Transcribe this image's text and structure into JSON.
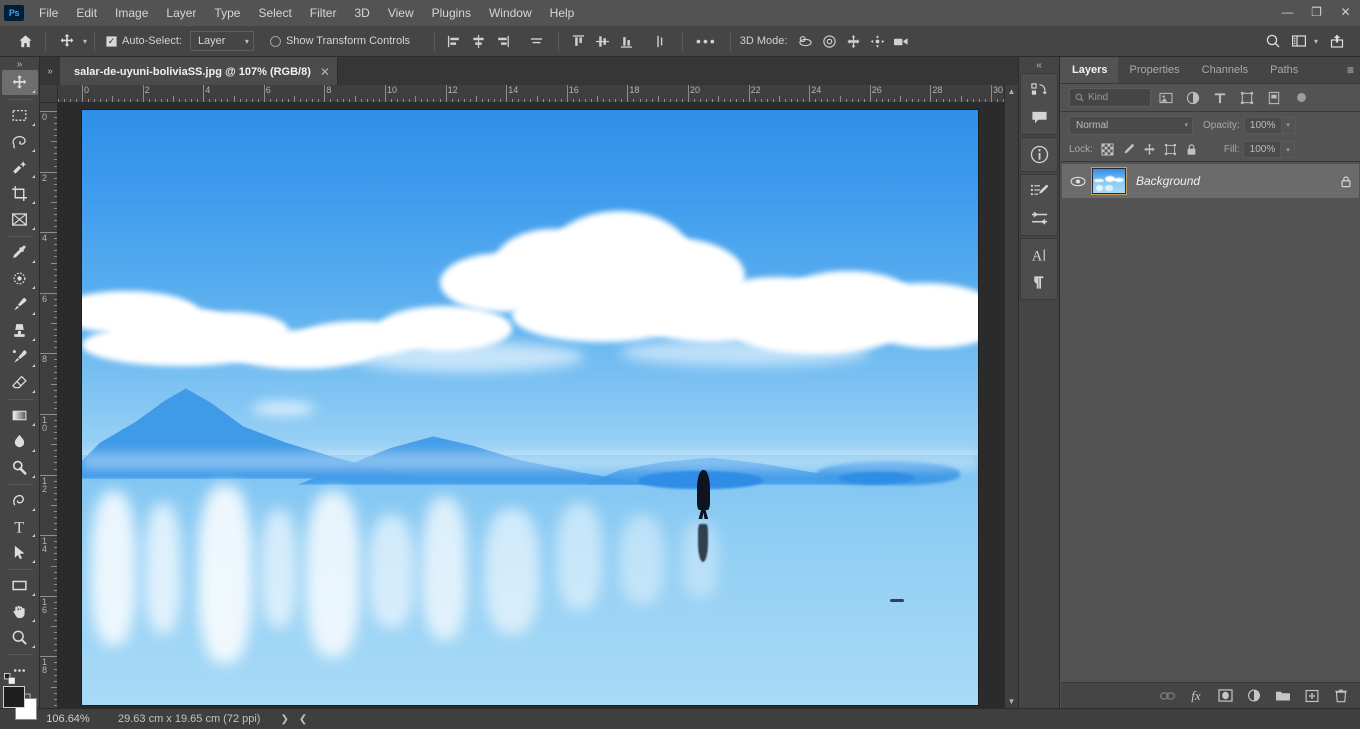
{
  "app": {
    "logo": "Ps"
  },
  "menubar": {
    "items": [
      "File",
      "Edit",
      "Image",
      "Layer",
      "Type",
      "Select",
      "Filter",
      "3D",
      "View",
      "Plugins",
      "Window",
      "Help"
    ]
  },
  "window_controls": {
    "minimize": "—",
    "maximize": "❐",
    "close": "✕"
  },
  "options_bar": {
    "home_icon": "home-icon",
    "tool_icon": "move-tool-icon",
    "auto_select_checked": true,
    "auto_select_label": "Auto-Select:",
    "auto_select_value": "Layer",
    "show_transform_checked": false,
    "show_transform_label": "Show Transform Controls",
    "align_group_1": [
      "align-left-edges",
      "align-horizontal-centers",
      "align-right-edges",
      "distribute-horizontally"
    ],
    "align_group_2": [
      "align-top-edges",
      "align-vertical-centers",
      "align-bottom-edges",
      "distribute-vertically"
    ],
    "more_label": "•••",
    "mode3d_label": "3D Mode:",
    "mode3d_icons": [
      "orbit-3d-icon",
      "roll-3d-icon",
      "pan-3d-icon",
      "slide-3d-icon",
      "camera-3d-icon"
    ],
    "right_icons": [
      "search-icon",
      "workspace-icon",
      "chevron-down-icon",
      "share-icon"
    ]
  },
  "tools": [
    {
      "name": "move-tool",
      "glyph": "✥",
      "active": true
    },
    {
      "name": "rectangular-marquee-tool",
      "glyph": "▭",
      "active": false
    },
    {
      "name": "lasso-tool",
      "glyph": "𓅮",
      "active": false
    },
    {
      "name": "object-selection-tool",
      "glyph": "✨",
      "active": false
    },
    {
      "name": "crop-tool",
      "glyph": "⌗",
      "active": false
    },
    {
      "name": "frame-tool",
      "glyph": "⊠",
      "active": false
    },
    {
      "name": "eyedropper-tool",
      "glyph": "⚲",
      "active": false
    },
    {
      "name": "spot-healing-brush-tool",
      "glyph": "◌",
      "active": false
    },
    {
      "name": "brush-tool",
      "glyph": "🖌",
      "active": false
    },
    {
      "name": "clone-stamp-tool",
      "glyph": "⌶",
      "active": false
    },
    {
      "name": "history-brush-tool",
      "glyph": "🖉",
      "active": false
    },
    {
      "name": "eraser-tool",
      "glyph": "▰",
      "active": false
    },
    {
      "name": "gradient-tool",
      "glyph": "▤",
      "active": false
    },
    {
      "name": "blur-tool",
      "glyph": "💧",
      "active": false
    },
    {
      "name": "dodge-tool",
      "glyph": "🔍",
      "active": false
    },
    {
      "name": "pen-tool",
      "glyph": "✒",
      "active": false
    },
    {
      "name": "horizontal-type-tool",
      "glyph": "T",
      "active": false
    },
    {
      "name": "path-selection-tool",
      "glyph": "➤",
      "active": false
    },
    {
      "name": "rectangle-tool",
      "glyph": "▭",
      "active": false
    },
    {
      "name": "hand-tool",
      "glyph": "✋",
      "active": false
    },
    {
      "name": "zoom-tool",
      "glyph": "🔎",
      "active": false
    },
    {
      "name": "edit-toolbar",
      "glyph": "•••",
      "active": false
    }
  ],
  "document": {
    "tab_title": "salar-de-uyuni-boliviaSS.jpg @ 107% (RGB/8)",
    "close_glyph": "✕",
    "collapse_glyph": "»"
  },
  "rulers": {
    "unit": "cm",
    "horizontal_labels": [
      "0",
      "2",
      "4",
      "6",
      "8",
      "10",
      "12",
      "14",
      "16",
      "18",
      "20",
      "22",
      "24",
      "26",
      "28",
      "30"
    ],
    "vertical_labels": [
      "0",
      "2",
      "4",
      "6",
      "8",
      "10",
      "12",
      "14",
      "16",
      "18"
    ]
  },
  "status_bar": {
    "zoom": "106.64%",
    "doc_size": "29.63 cm x 19.65 cm (72 ppi)",
    "caret_right": "❯",
    "caret_left": "❮",
    "scroll_arrow_right": "❯"
  },
  "rail": {
    "collapse_glyph": "«",
    "groups": [
      {
        "icons": [
          {
            "name": "libraries-icon",
            "glyph": "⧉"
          },
          {
            "name": "comments-icon",
            "glyph": "🗩"
          }
        ]
      },
      {
        "icons": [
          {
            "name": "info-icon",
            "glyph": "ⓘ"
          }
        ]
      },
      {
        "icons": [
          {
            "name": "adjustments-icon",
            "glyph": "☵"
          },
          {
            "name": "properties-sliders-icon",
            "glyph": "⚞"
          }
        ]
      },
      {
        "icons": [
          {
            "name": "character-icon",
            "glyph": "A"
          },
          {
            "name": "paragraph-icon",
            "glyph": "¶"
          }
        ]
      }
    ]
  },
  "panel": {
    "tabs": [
      {
        "label": "Layers",
        "active": true
      },
      {
        "label": "Properties",
        "active": false
      },
      {
        "label": "Channels",
        "active": false
      },
      {
        "label": "Paths",
        "active": false
      }
    ],
    "menu_glyph": "≡",
    "filter": {
      "kind_label": "Kind",
      "search_icon": "search-icon",
      "type_filters": [
        {
          "name": "filter-pixel-layers-icon",
          "glyph": "▣"
        },
        {
          "name": "filter-adjustment-layers-icon",
          "glyph": "◐"
        },
        {
          "name": "filter-type-layers-icon",
          "glyph": "T"
        },
        {
          "name": "filter-shape-layers-icon",
          "glyph": "⛶"
        },
        {
          "name": "filter-smart-objects-icon",
          "glyph": "❏"
        }
      ],
      "toggle_name": "filter-toggle-switch"
    },
    "blend": {
      "mode": "Normal",
      "opacity_label": "Opacity:",
      "opacity_value": "100%",
      "fill_label": "Fill:",
      "fill_value": "100%"
    },
    "lock": {
      "label": "Lock:",
      "icons": [
        {
          "name": "lock-transparent-pixels-icon",
          "glyph": "▦"
        },
        {
          "name": "lock-image-pixels-icon",
          "glyph": "🖌"
        },
        {
          "name": "lock-position-icon",
          "glyph": "✥"
        },
        {
          "name": "lock-artboard-nesting-icon",
          "glyph": "⛶"
        },
        {
          "name": "lock-all-icon",
          "glyph": "🔒"
        }
      ]
    },
    "layers": [
      {
        "name": "Background",
        "visible": true,
        "locked": true,
        "eye_glyph": "👁",
        "lock_glyph": "🔒"
      }
    ],
    "footer_icons": [
      {
        "name": "link-layers-icon",
        "glyph": "⛓",
        "dim": true
      },
      {
        "name": "layer-style-fx-icon",
        "glyph": "fx",
        "dim": false
      },
      {
        "name": "add-layer-mask-icon",
        "glyph": "◙",
        "dim": false
      },
      {
        "name": "new-adjustment-layer-icon",
        "glyph": "◑",
        "dim": false
      },
      {
        "name": "new-group-icon",
        "glyph": "🗀",
        "dim": false
      },
      {
        "name": "new-layer-icon",
        "glyph": "⊞",
        "dim": false
      },
      {
        "name": "delete-layer-icon",
        "glyph": "🗑",
        "dim": false
      }
    ]
  },
  "colors": {
    "accent_blue": "#31a8ff",
    "panel_bg": "#535353",
    "bar_bg": "#454545",
    "canvas_bg": "#2b2b2b",
    "sky_blue": "#2f8fe8",
    "water_blue": "#8ccbf3",
    "foreground_swatch": "#1f1f1f",
    "background_swatch": "#ffffff"
  },
  "image_content": {
    "description": "Salar de Uyuni Bolivia salt flat with mirror reflection",
    "subjects": [
      "sky",
      "cumulus-clouds",
      "mountain-range",
      "person-silhouette",
      "reflection",
      "island"
    ]
  }
}
